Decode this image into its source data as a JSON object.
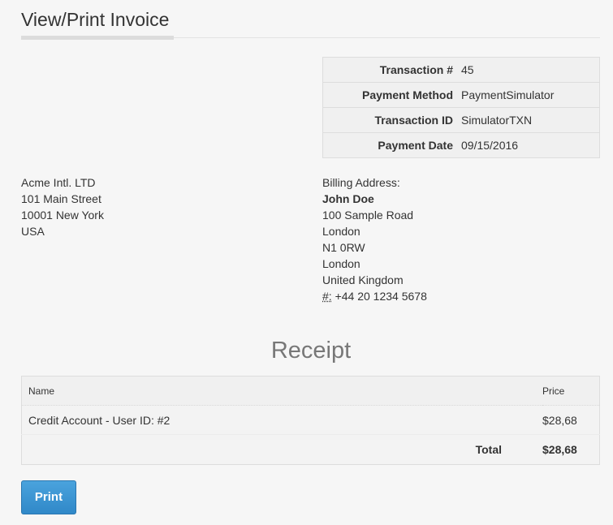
{
  "header": {
    "title": "View/Print Invoice"
  },
  "transaction": {
    "rows": [
      {
        "label": "Transaction #",
        "value": "45"
      },
      {
        "label": "Payment Method",
        "value": "PaymentSimulator"
      },
      {
        "label": "Transaction ID",
        "value": "SimulatorTXN"
      },
      {
        "label": "Payment Date",
        "value": "09/15/2016"
      }
    ]
  },
  "company_address": {
    "lines": [
      "Acme Intl. LTD",
      "101 Main Street",
      "10001 New York",
      "USA"
    ]
  },
  "billing_address": {
    "heading": "Billing Address:",
    "name": "John Doe",
    "lines": [
      "100 Sample Road",
      "London",
      "N1 0RW",
      "London",
      "United Kingdom"
    ],
    "phone_abbr": "#:",
    "phone": "+44 20 1234 5678"
  },
  "receipt": {
    "heading": "Receipt",
    "columns": {
      "name": "Name",
      "price": "Price"
    },
    "items": [
      {
        "name": "Credit Account - User ID: #2",
        "price": "$28,68"
      }
    ],
    "total_label": "Total",
    "total_value": "$28,68"
  },
  "actions": {
    "print_label": "Print"
  }
}
